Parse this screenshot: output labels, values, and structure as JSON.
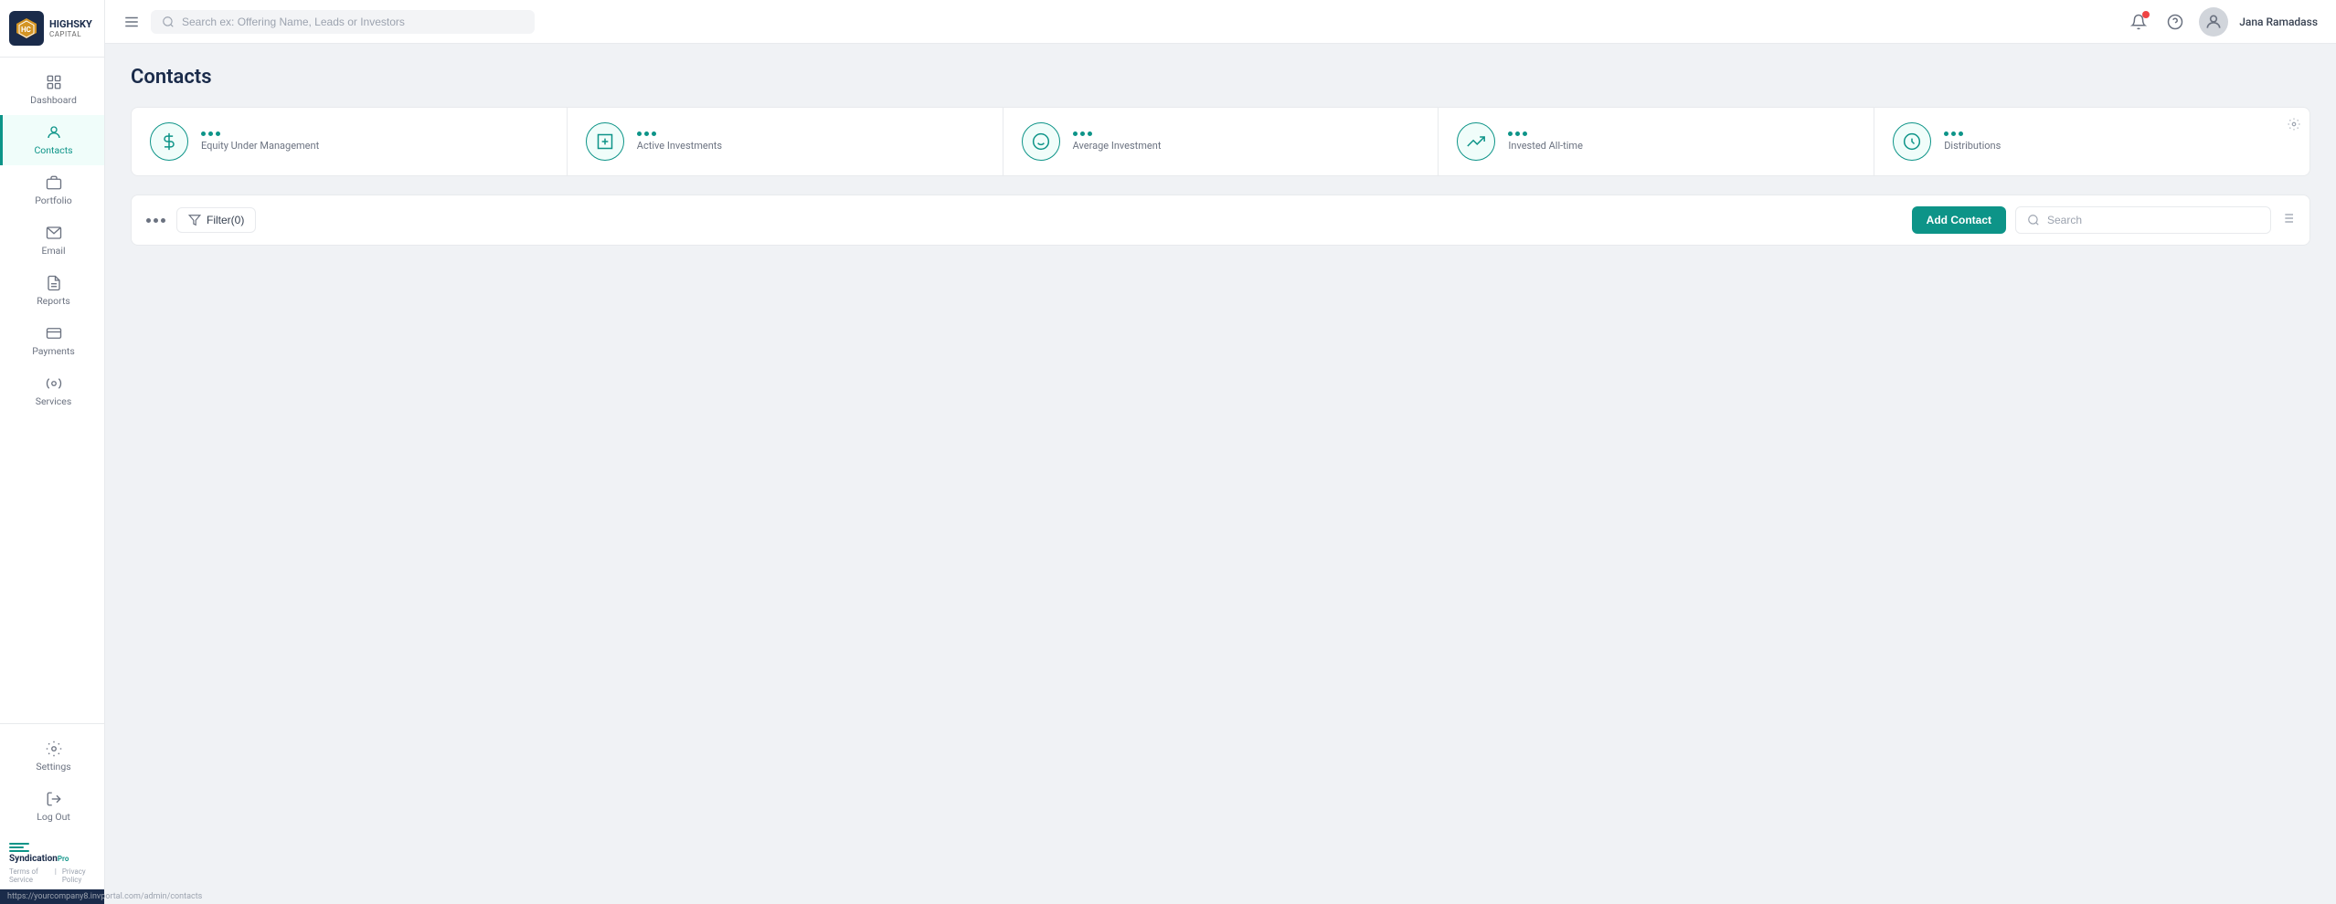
{
  "app": {
    "name": "HIGHSKY",
    "subtitle": "capital",
    "menu_icon": "≡"
  },
  "topnav": {
    "search_placeholder": "Search ex: Offering Name, Leads or Investors",
    "username": "Jana Ramadass"
  },
  "sidebar": {
    "items": [
      {
        "id": "dashboard",
        "label": "Dashboard",
        "active": false
      },
      {
        "id": "contacts",
        "label": "Contacts",
        "active": true
      },
      {
        "id": "portfolio",
        "label": "Portfolio",
        "active": false
      },
      {
        "id": "email",
        "label": "Email",
        "active": false
      },
      {
        "id": "reports",
        "label": "Reports",
        "active": false
      },
      {
        "id": "payments",
        "label": "Payments",
        "active": false
      },
      {
        "id": "services",
        "label": "Services",
        "active": false
      }
    ],
    "bottom_items": [
      {
        "id": "settings",
        "label": "Settings"
      },
      {
        "id": "logout",
        "label": "Log Out"
      }
    ]
  },
  "page": {
    "title": "Contacts"
  },
  "stats": [
    {
      "id": "equity",
      "label": "Equity Under Management"
    },
    {
      "id": "active",
      "label": "Active Investments"
    },
    {
      "id": "average",
      "label": "Average Investment"
    },
    {
      "id": "invested",
      "label": "Invested All-time"
    },
    {
      "id": "distributions",
      "label": "Distributions"
    }
  ],
  "toolbar": {
    "filter_label": "Filter(0)",
    "add_contact_label": "Add Contact",
    "search_placeholder": "Search"
  },
  "footer": {
    "brand": "Syndication",
    "brand_sub": "Pro",
    "links": [
      "Terms of Service",
      "Privacy Policy"
    ],
    "url": "https://yourcompany8.invportal.com/admin/contacts"
  }
}
